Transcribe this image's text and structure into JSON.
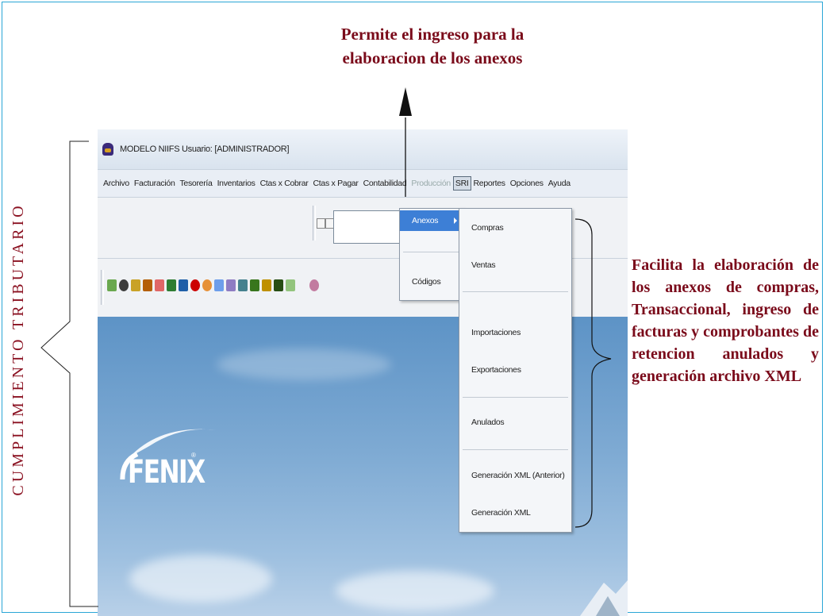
{
  "annotations": {
    "top_line1": "Permite el ingreso para la",
    "top_line2": "elaboracion de los anexos",
    "right_text": "Facilita la elaboración de los anexos de compras, Transaccional, ingreso de facturas y comprobantes de retencion anulados y generación archivo XML",
    "left_text": "CUMPLIMIENTO TRIBUTARIO"
  },
  "app": {
    "title": "MODELO NIIFS  Usuario: [ADMINISTRADOR]",
    "menu": [
      {
        "label": "Archivo",
        "state": "normal"
      },
      {
        "label": "Facturación",
        "state": "normal"
      },
      {
        "label": "Tesorería",
        "state": "normal"
      },
      {
        "label": "Inventarios",
        "state": "normal"
      },
      {
        "label": "Ctas x Cobrar",
        "state": "normal"
      },
      {
        "label": "Ctas x Pagar",
        "state": "normal"
      },
      {
        "label": "Contabilidad",
        "state": "normal"
      },
      {
        "label": "Producción",
        "state": "disabled"
      },
      {
        "label": "SRI",
        "state": "active"
      },
      {
        "label": "Reportes",
        "state": "normal"
      },
      {
        "label": "Opciones",
        "state": "normal"
      },
      {
        "label": "Ayuda",
        "state": "normal"
      }
    ],
    "sri_menu": {
      "anexos": "Anexos",
      "codigos": "Códigos"
    },
    "anexos_submenu": {
      "compras": "Compras",
      "ventas": "Ventas",
      "importaciones": "Importaciones",
      "exportaciones": "Exportaciones",
      "anulados": "Anulados",
      "xml_anterior": "Generación XML (Anterior)",
      "xml": "Generación XML"
    },
    "brand": "FENIX",
    "brand_mark": "®"
  },
  "colors": {
    "annotation": "#7a0a1a",
    "frame": "#2aa6d6",
    "menu_selected": "#3d7fd6",
    "desktop": "#7eaad3"
  }
}
